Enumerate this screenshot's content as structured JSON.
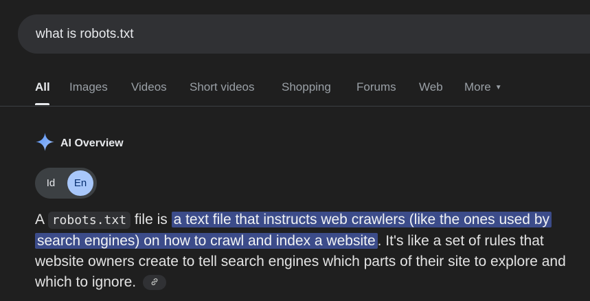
{
  "search": {
    "query": "what is robots.txt"
  },
  "tabs": [
    {
      "label": "All",
      "active": true
    },
    {
      "label": "Images"
    },
    {
      "label": "Videos"
    },
    {
      "label": "Short videos"
    },
    {
      "label": "Shopping"
    },
    {
      "label": "Forums"
    },
    {
      "label": "Web"
    },
    {
      "label": "More"
    }
  ],
  "ai_overview": {
    "icon": "sparkle-icon",
    "title": "AI Overview",
    "languages": [
      {
        "label": "Id",
        "selected": false
      },
      {
        "label": "En",
        "selected": true
      }
    ],
    "answer": {
      "part1": "A ",
      "code": "robots.txt",
      "part2": " file is ",
      "highlight": "a text file that instructs web crawlers (like the ones used by search engines) on how to crawl and index a website",
      "part3": ". It's like a set of rules that website owners create to tell search engines which parts of their site to explore and which to ignore. "
    },
    "link_icon": "link-icon"
  },
  "colors": {
    "background": "#1f1f1f",
    "highlight": "#3c4c8a",
    "accent": "#a8c7fa"
  }
}
